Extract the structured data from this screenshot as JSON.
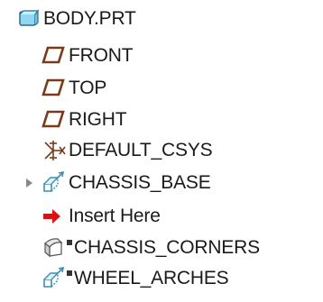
{
  "model_tree": {
    "root": {
      "label": "BODY.PRT",
      "icon": "part-icon"
    },
    "items": [
      {
        "label": "FRONT",
        "icon": "datum-plane-icon"
      },
      {
        "label": "TOP",
        "icon": "datum-plane-icon"
      },
      {
        "label": "RIGHT",
        "icon": "datum-plane-icon"
      },
      {
        "label": "DEFAULT_CSYS",
        "icon": "coordinate-system-icon"
      },
      {
        "label": "CHASSIS_BASE",
        "icon": "extrude-feature-icon",
        "expandable": true
      },
      {
        "label": "Insert Here",
        "icon": "insert-arrow-icon"
      },
      {
        "label": "CHASSIS_CORNERS",
        "icon": "round-feature-icon"
      },
      {
        "label": "WHEEL_ARCHES",
        "icon": "extrude-feature-icon"
      }
    ]
  },
  "colors": {
    "part_icon_fill": "#8fd8f0",
    "datum_plane_stroke": "#7a3a18",
    "insert_arrow": "#e01010",
    "feature_icon_stroke": "#3a8fb0"
  }
}
